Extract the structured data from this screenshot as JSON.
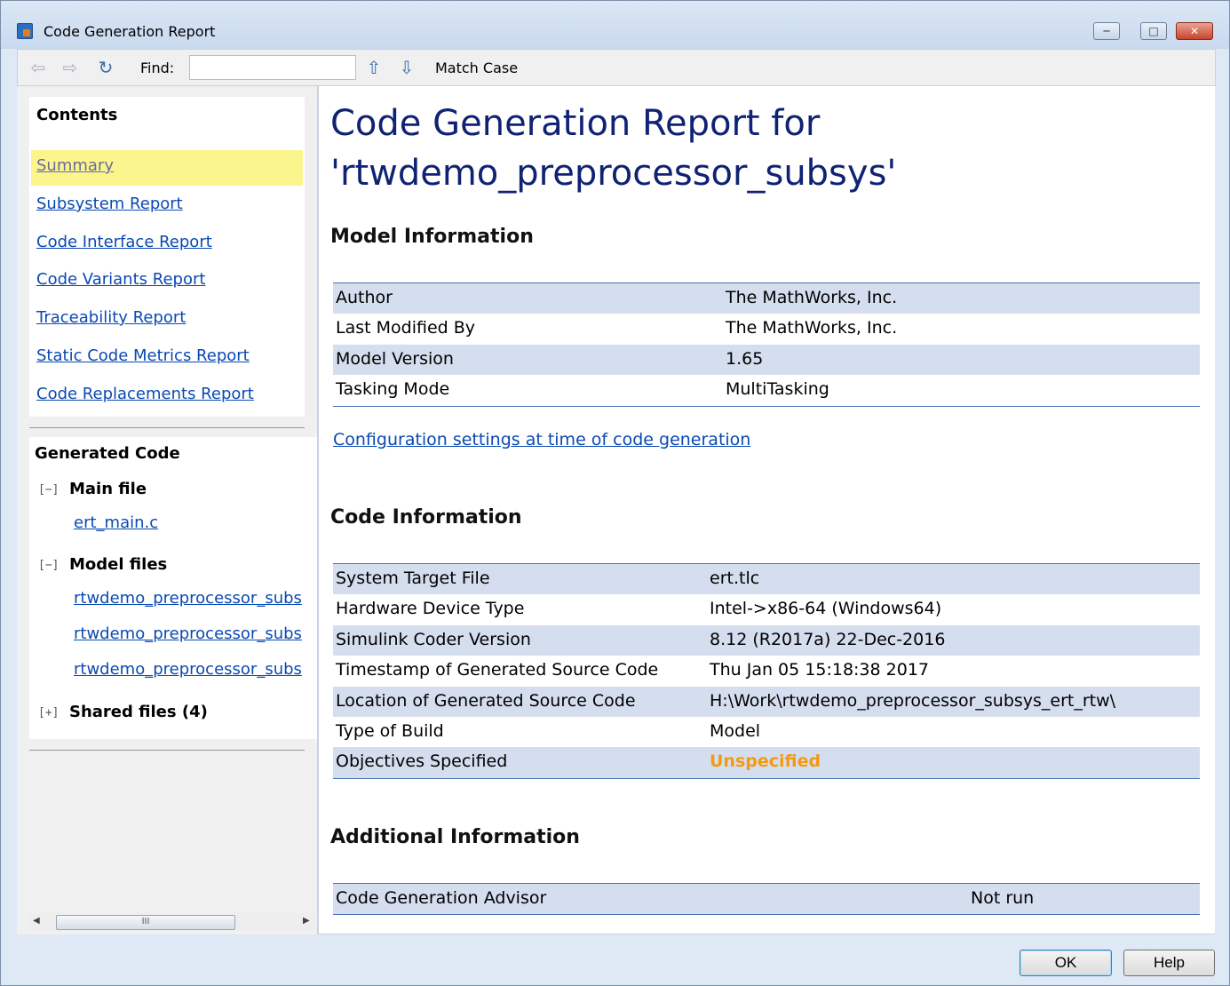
{
  "window": {
    "title": "Code Generation Report"
  },
  "toolbar": {
    "find_label": "Find:",
    "find_value": "",
    "match_case": "Match Case"
  },
  "contents": {
    "title": "Contents",
    "links": [
      "Summary",
      "Subsystem Report",
      "Code Interface Report",
      "Code Variants Report",
      "Traceability Report",
      "Static Code Metrics Report",
      "Code Replacements Report"
    ]
  },
  "generated": {
    "title": "Generated Code",
    "collapse_glyph": "[−]",
    "expand_glyph": "[+]",
    "main_file": {
      "label": "Main file",
      "files": [
        "ert_main.c"
      ]
    },
    "model_files": {
      "label": "Model files",
      "files": [
        "rtwdemo_preprocessor_subs",
        "rtwdemo_preprocessor_subs",
        "rtwdemo_preprocessor_subs"
      ]
    },
    "shared_files": {
      "label": "Shared files (4)"
    }
  },
  "scrollbar": {
    "thumb_grip": "III"
  },
  "report": {
    "title_line1": "Code Generation Report for",
    "title_line2": "'rtwdemo_preprocessor_subsys'",
    "model_info": {
      "heading": "Model Information",
      "rows": [
        [
          "Author",
          "The MathWorks, Inc."
        ],
        [
          "Last Modified By",
          "The MathWorks, Inc."
        ],
        [
          "Model Version",
          "1.65"
        ],
        [
          "Tasking Mode",
          "MultiTasking"
        ]
      ]
    },
    "config_link": "Configuration settings at time of code generation",
    "code_info": {
      "heading": "Code Information",
      "rows": [
        [
          "System Target File",
          "ert.tlc"
        ],
        [
          "Hardware Device Type",
          "Intel->x86-64 (Windows64)"
        ],
        [
          "Simulink Coder Version",
          "8.12 (R2017a) 22-Dec-2016"
        ],
        [
          "Timestamp of Generated Source Code",
          "Thu Jan 05 15:18:38 2017"
        ],
        [
          "Location of Generated Source Code",
          "H:\\Work\\rtwdemo_preprocessor_subsys_ert_rtw\\"
        ],
        [
          "Type of Build",
          "Model"
        ],
        [
          "Objectives Specified",
          "Unspecified"
        ]
      ]
    },
    "additional_info": {
      "heading": "Additional Information",
      "rows": [
        [
          "Code Generation Advisor",
          "Not run"
        ]
      ]
    }
  },
  "buttons": {
    "ok": "OK",
    "help": "Help"
  },
  "colors": {
    "link": "#0a49b4",
    "title": "#0f2273",
    "highlight": "#fbf58e",
    "row_shade": "#d5deef",
    "warning": "#f39a13"
  }
}
